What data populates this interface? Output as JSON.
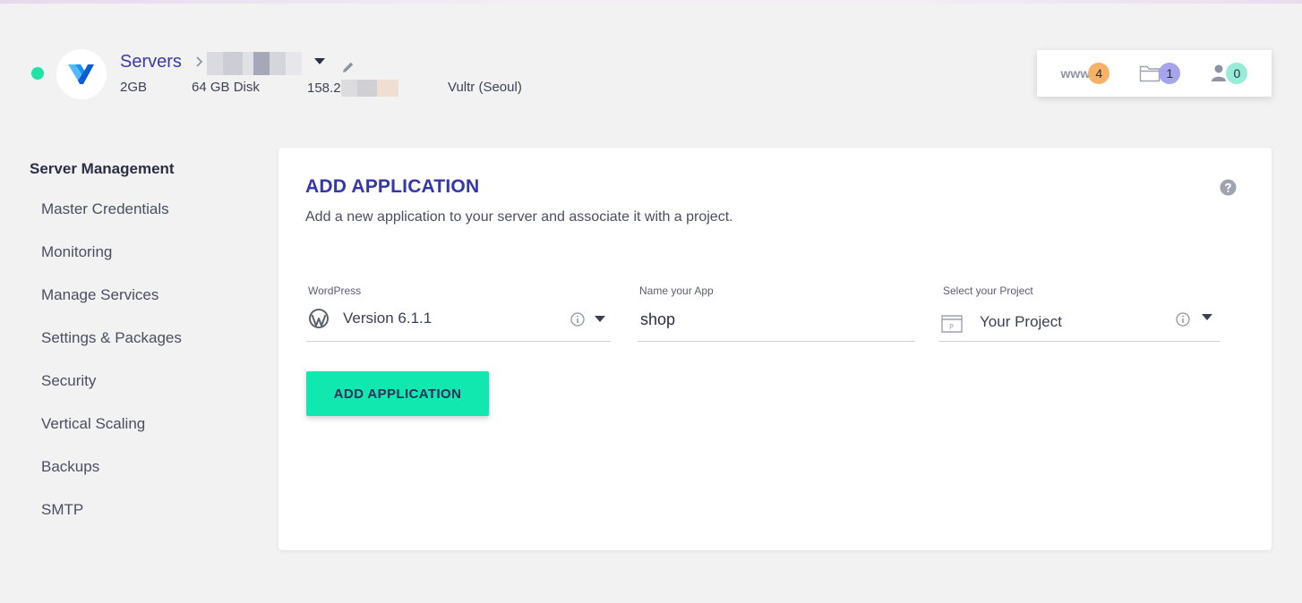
{
  "server": {
    "breadcrumb_root": "Servers",
    "ram": "2GB",
    "disk": "64 GB Disk",
    "ip_prefix": "158.2",
    "location": "Vultr (Seoul)",
    "status_color": "#1ee3a2"
  },
  "counters": {
    "www_label": "www",
    "apps_count": "4",
    "projects_count": "1",
    "users_count": "0"
  },
  "sidebar": {
    "title": "Server Management",
    "items": [
      {
        "label": "Master Credentials"
      },
      {
        "label": "Monitoring"
      },
      {
        "label": "Manage Services"
      },
      {
        "label": "Settings & Packages"
      },
      {
        "label": "Security"
      },
      {
        "label": "Vertical Scaling"
      },
      {
        "label": "Backups"
      },
      {
        "label": "SMTP"
      }
    ]
  },
  "form": {
    "title": "ADD APPLICATION",
    "subtitle": "Add a new application to your server and associate it with a project.",
    "app_type_label": "WordPress",
    "app_version": "Version 6.1.1",
    "name_label": "Name your App",
    "name_value": "shop",
    "project_label": "Select your Project",
    "project_value": "Your Project",
    "submit_label": "ADD APPLICATION"
  },
  "colors": {
    "accent_blue": "#3337a8",
    "button_green": "#10e8b0",
    "badge_orange": "#f7b267",
    "badge_purple": "#a6a4ea",
    "badge_green": "#97ecd7"
  }
}
